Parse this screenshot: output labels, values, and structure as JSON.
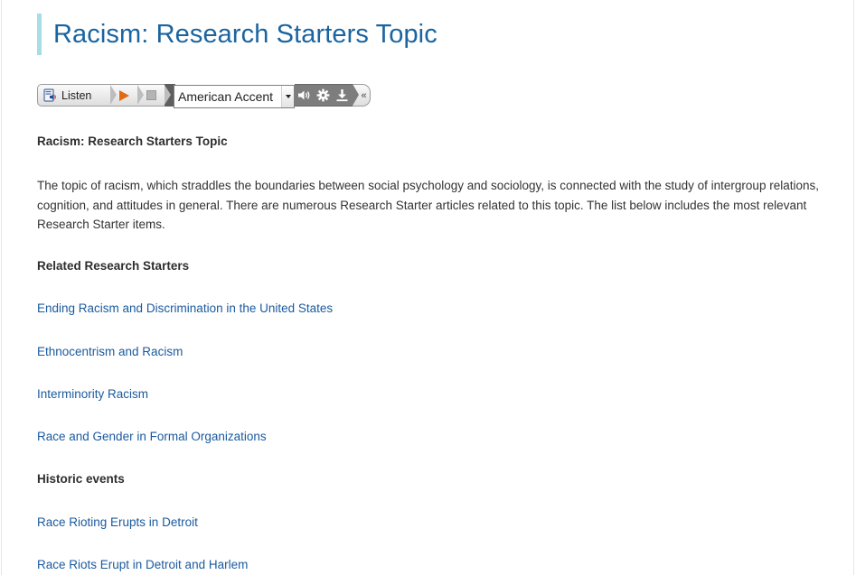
{
  "page": {
    "title": "Racism: Research Starters Topic"
  },
  "toolbar": {
    "listen_label": "Listen",
    "accent_value": "American Accent",
    "collapse_label": "«"
  },
  "article": {
    "heading": "Racism: Research Starters Topic",
    "intro": "The topic of racism, which straddles the boundaries between social psychology and sociology, is connected with the study of intergroup relations, cognition, and attitudes in general. There are numerous Research Starter articles related to this topic. The list below includes the most relevant Research Starter items.",
    "related_heading": "Related Research Starters",
    "related_links": [
      "Ending Racism and Discrimination in the United States",
      "Ethnocentrism and Racism",
      "Interminority Racism",
      "Race and Gender in Formal Organizations"
    ],
    "historic_heading": "Historic events",
    "historic_links": [
      "Race Rioting Erupts in Detroit",
      "Race Riots Erupt in Detroit and Harlem"
    ]
  },
  "icons": {
    "listen": "speaker-book-icon",
    "play": "play-icon",
    "stop": "stop-icon",
    "volume": "volume-icon",
    "settings": "gear-icon",
    "download": "download-icon"
  },
  "colors": {
    "title": "#1a64a0",
    "title_bar": "#a7dde4",
    "link": "#1a5a9e",
    "play": "#e36a13"
  }
}
